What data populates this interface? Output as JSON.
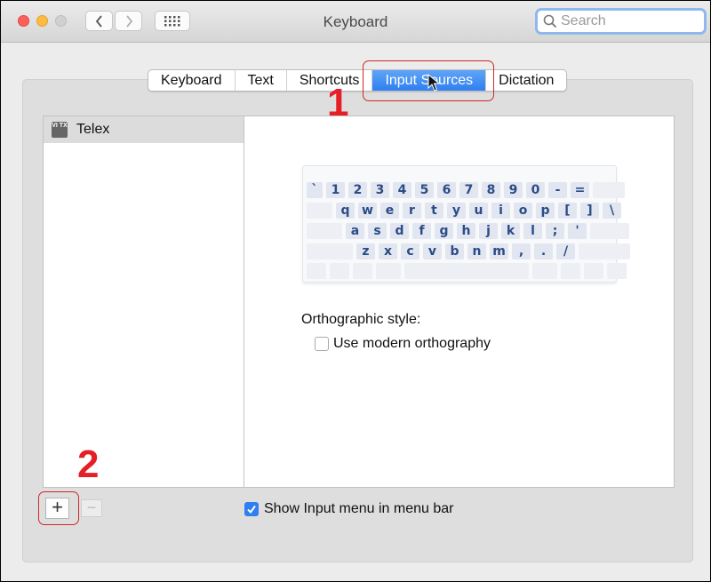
{
  "window": {
    "title": "Keyboard"
  },
  "search": {
    "placeholder": "Search",
    "value": ""
  },
  "tabs": [
    {
      "label": "Keyboard",
      "active": false
    },
    {
      "label": "Text",
      "active": false
    },
    {
      "label": "Shortcuts",
      "active": false
    },
    {
      "label": "Input Sources",
      "active": true
    },
    {
      "label": "Dictation",
      "active": false
    }
  ],
  "input_sources": {
    "items": [
      {
        "label": "Telex",
        "icon_text": "VI TX",
        "selected": true
      }
    ]
  },
  "keyboard_layout": {
    "rows": [
      [
        "`",
        "1",
        "2",
        "3",
        "4",
        "5",
        "6",
        "7",
        "8",
        "9",
        "0",
        "-",
        "="
      ],
      [
        "q",
        "w",
        "e",
        "r",
        "t",
        "y",
        "u",
        "i",
        "o",
        "p",
        "[",
        "]",
        "\\"
      ],
      [
        "a",
        "s",
        "d",
        "f",
        "g",
        "h",
        "j",
        "k",
        "l",
        ";",
        "'"
      ],
      [
        "z",
        "x",
        "c",
        "v",
        "b",
        "n",
        "m",
        ",",
        ".",
        "/"
      ]
    ]
  },
  "orthographic": {
    "label": "Orthographic style:",
    "option_label": "Use modern orthography",
    "option_checked": false
  },
  "bottom": {
    "add_label": "+",
    "remove_label": "−",
    "show_menu_label": "Show Input menu in menu bar",
    "show_menu_checked": true
  },
  "annotations": {
    "step1": "1",
    "step2": "2"
  },
  "colors": {
    "accent": "#2f7ff0",
    "annotation": "#e61e25"
  }
}
